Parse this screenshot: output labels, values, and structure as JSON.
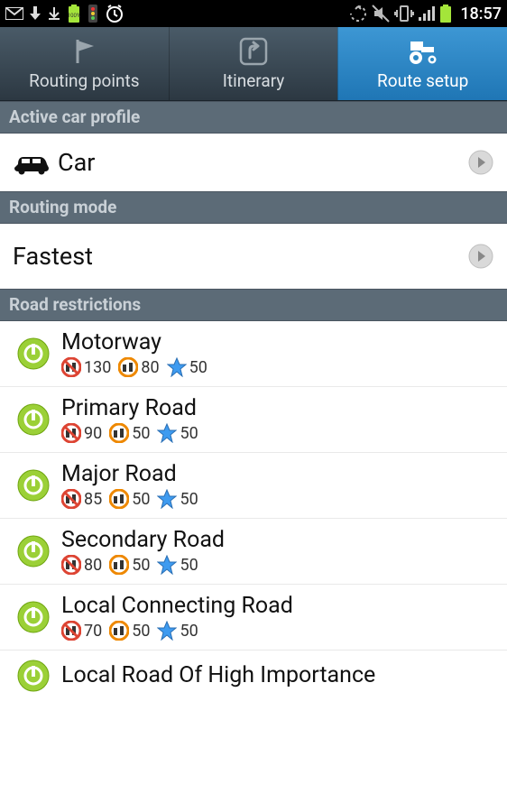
{
  "status": {
    "time": "18:57",
    "battery_badge": "100%"
  },
  "tabs": [
    {
      "label": "Routing points",
      "iconName": "flag-icon",
      "active": false
    },
    {
      "label": "Itinerary",
      "iconName": "turn-icon",
      "active": false
    },
    {
      "label": "Route setup",
      "iconName": "tractor-icon",
      "active": true
    }
  ],
  "sections": {
    "profile_header": "Active car profile",
    "profile_value": "Car",
    "mode_header": "Routing mode",
    "mode_value": "Fastest",
    "restrictions_header": "Road restrictions"
  },
  "restrictions": [
    {
      "name": "Motorway",
      "v1": "130",
      "v2": "80",
      "v3": "50"
    },
    {
      "name": "Primary Road",
      "v1": "90",
      "v2": "50",
      "v3": "50"
    },
    {
      "name": "Major Road",
      "v1": "85",
      "v2": "50",
      "v3": "50"
    },
    {
      "name": "Secondary Road",
      "v1": "80",
      "v2": "50",
      "v3": "50"
    },
    {
      "name": "Local Connecting Road",
      "v1": "70",
      "v2": "50",
      "v3": "50"
    },
    {
      "name": "Local Road Of High Importance",
      "v1": "",
      "v2": "",
      "v3": ""
    }
  ]
}
